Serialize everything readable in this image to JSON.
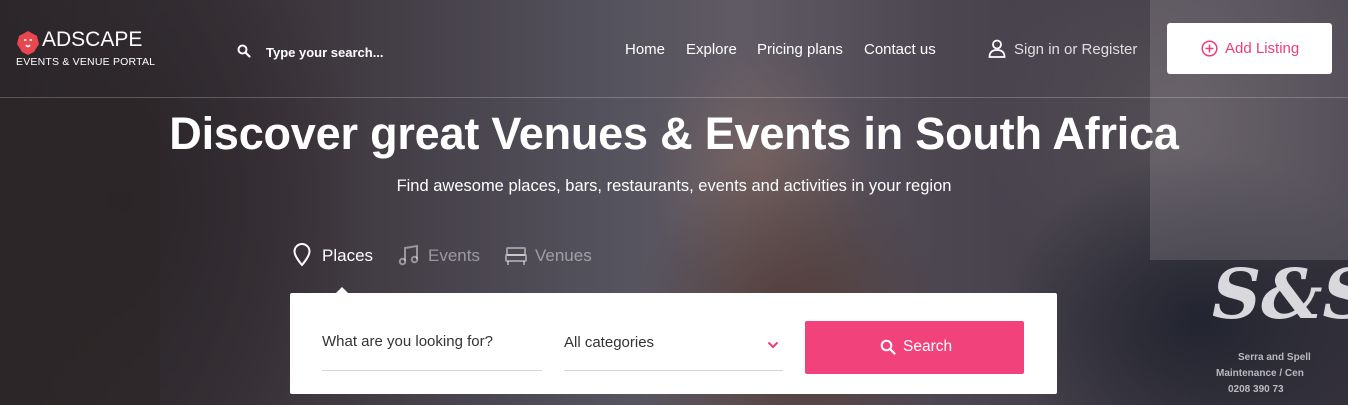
{
  "colors": {
    "accent": "#f2427c",
    "add_listing_text": "#ec3d76",
    "logo_mark": "#e8474f"
  },
  "header": {
    "logo": {
      "name": "ADSCAPE",
      "tagline": "EVENTS & VENUE PORTAL"
    },
    "search": {
      "placeholder": "Type your search..."
    },
    "nav": [
      "Home",
      "Explore",
      "Pricing plans",
      "Contact us"
    ],
    "signin": "Sign in or Register",
    "add_listing": "Add Listing"
  },
  "hero": {
    "title": "Discover great Venues & Events in South Africa",
    "subtitle": "Find awesome places, bars, restaurants, events and activities in your region",
    "van_logo": "S&S",
    "van_lines": [
      "Serra and Spell",
      "Maintenance / Cen",
      "0208 390 73"
    ]
  },
  "tabs": [
    {
      "label": "Places",
      "icon": "map-pin-icon",
      "active": true
    },
    {
      "label": "Events",
      "icon": "music-note-icon",
      "active": false
    },
    {
      "label": "Venues",
      "icon": "bed-icon",
      "active": false
    }
  ],
  "search_form": {
    "keyword_placeholder": "What are you looking for?",
    "category_selected": "All categories",
    "button_label": "Search"
  }
}
